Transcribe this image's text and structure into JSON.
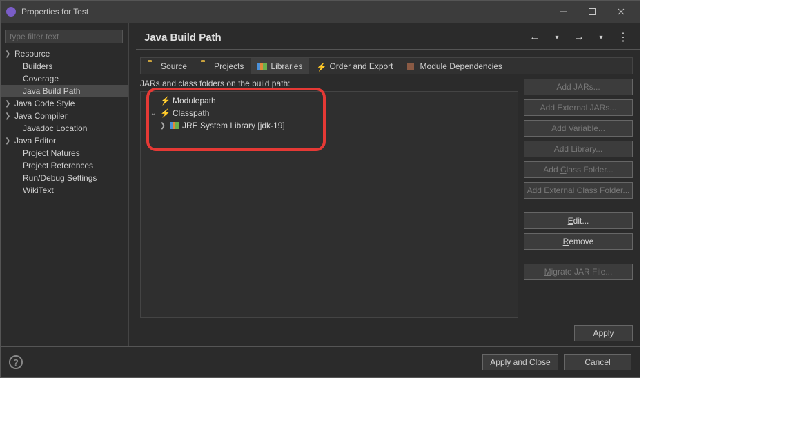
{
  "window": {
    "title": "Properties for Test"
  },
  "sidebar": {
    "filter_placeholder": "type filter text",
    "items": [
      {
        "label": "Resource",
        "expandable": true
      },
      {
        "label": "Builders",
        "expandable": false
      },
      {
        "label": "Coverage",
        "expandable": false
      },
      {
        "label": "Java Build Path",
        "expandable": false,
        "selected": true
      },
      {
        "label": "Java Code Style",
        "expandable": true
      },
      {
        "label": "Java Compiler",
        "expandable": true
      },
      {
        "label": "Javadoc Location",
        "expandable": false
      },
      {
        "label": "Java Editor",
        "expandable": true
      },
      {
        "label": "Project Natures",
        "expandable": false
      },
      {
        "label": "Project References",
        "expandable": false
      },
      {
        "label": "Run/Debug Settings",
        "expandable": false
      },
      {
        "label": "WikiText",
        "expandable": false
      }
    ]
  },
  "main": {
    "heading": "Java Build Path",
    "tabs": [
      {
        "label": "Source",
        "mnemonic": "S",
        "icon": "folder"
      },
      {
        "label": "Projects",
        "mnemonic": "P",
        "icon": "folder"
      },
      {
        "label": "Libraries",
        "mnemonic": "L",
        "icon": "lib",
        "active": true
      },
      {
        "label": "Order and Export",
        "mnemonic": "O",
        "icon": "bolt"
      },
      {
        "label": "Module Dependencies",
        "mnemonic": "M",
        "icon": "mod"
      }
    ],
    "description": "JARs and class folders on the build path:",
    "tree": {
      "modulepath": "Modulepath",
      "classpath": "Classpath",
      "jre": "JRE System Library [jdk-19]"
    },
    "buttons": {
      "add_jars": "Add JARs...",
      "add_external_jars": "Add External JARs...",
      "add_variable": "Add Variable...",
      "add_library": "Add Library...",
      "add_class_folder": "Add Class Folder...",
      "add_external_class_folder": "Add External Class Folder...",
      "edit": "Edit...",
      "remove": "Remove",
      "migrate": "Migrate JAR File...",
      "apply": "Apply"
    }
  },
  "footer": {
    "apply_close": "Apply and Close",
    "cancel": "Cancel"
  }
}
